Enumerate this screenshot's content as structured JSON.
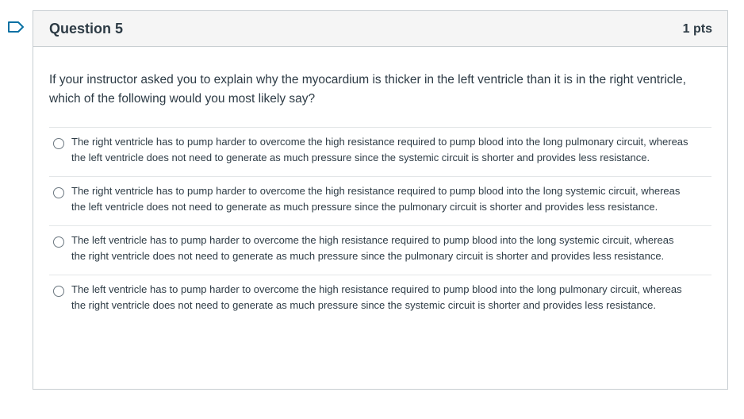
{
  "colors": {
    "flag": "#0770a3",
    "text": "#2d3b45",
    "header_bg": "#f5f5f5",
    "border": "#c7cdd1"
  },
  "flag_icon": "bookmark-flag-icon",
  "question": {
    "title": "Question 5",
    "points": "1 pts",
    "text": "If your instructor asked you to explain why the myocardium is thicker in the left ventricle than it is in the right ventricle, which of the following would you most likely say?",
    "answers": [
      {
        "label": "The right ventricle has to pump harder to overcome the high resistance required to pump blood into the long pulmonary circuit, whereas the left ventricle does not need to generate as much pressure since the systemic circuit is shorter and provides less resistance.",
        "selected": false
      },
      {
        "label": "The right ventricle has to pump harder to overcome the high resistance required to pump blood into the long systemic circuit, whereas the left ventricle does not need to generate as much pressure since the pulmonary circuit is shorter and provides less resistance.",
        "selected": false
      },
      {
        "label": "The left ventricle has to pump harder to overcome the high resistance required to pump blood into the long systemic circuit, whereas the right ventricle does not need to generate as much pressure since the pulmonary circuit is shorter and provides less resistance.",
        "selected": false
      },
      {
        "label": "The left ventricle has to pump harder to overcome the high resistance required to pump blood into the long pulmonary circuit, whereas the right ventricle does not need to generate as much pressure since the systemic circuit is shorter and provides less resistance.",
        "selected": false
      }
    ]
  }
}
